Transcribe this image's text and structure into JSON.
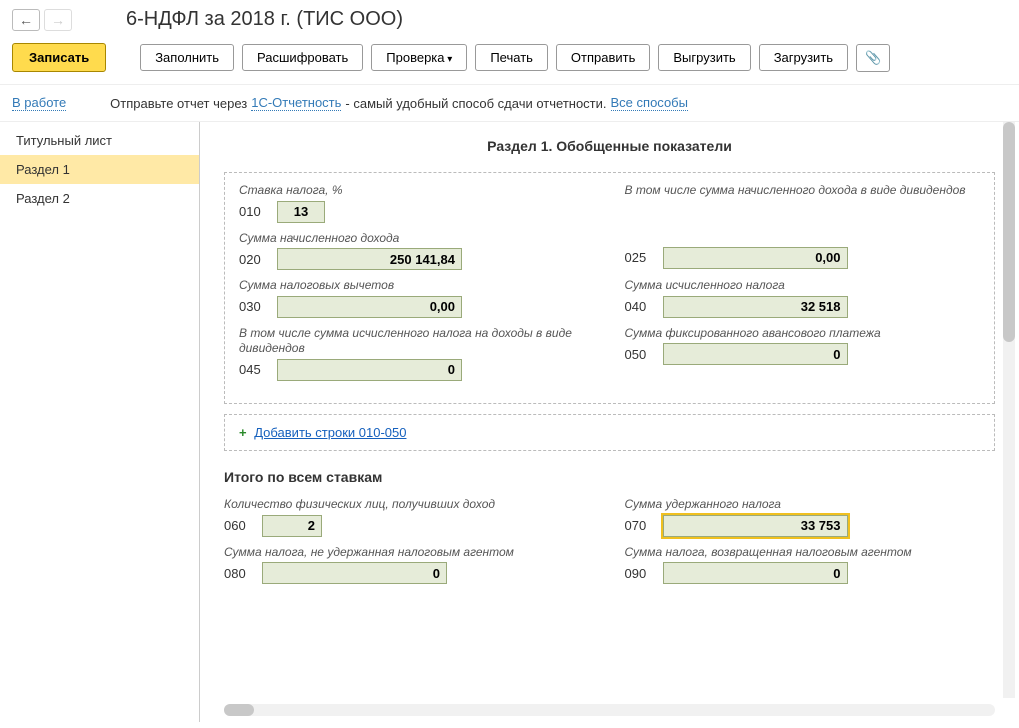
{
  "header": {
    "title": "6-НДФЛ за 2018 г. (ТИС ООО)"
  },
  "toolbar": {
    "save": "Записать",
    "fill": "Заполнить",
    "decrypt": "Расшифровать",
    "check": "Проверка",
    "print": "Печать",
    "send": "Отправить",
    "unload": "Выгрузить",
    "load": "Загрузить"
  },
  "status": {
    "label": "В работе",
    "hint_prefix": "Отправьте отчет через",
    "hint_link": "1С-Отчетность",
    "hint_suffix": "- самый удобный способ сдачи отчетности.",
    "all_ways": "Все способы"
  },
  "nav": {
    "title_page": "Титульный лист",
    "section1": "Раздел 1",
    "section2": "Раздел 2"
  },
  "section1": {
    "heading": "Раздел 1. Обобщенные показатели",
    "labels": {
      "rate": "Ставка налога, %",
      "income_sum": "Сумма начисленного дохода",
      "income_div": "В том числе сумма начисленного дохода в виде дивидендов",
      "deductions": "Сумма налоговых вычетов",
      "calc_tax": "Сумма исчисленного налога",
      "calc_tax_div": "В том числе сумма исчисленного налога на доходы в виде дивидендов",
      "fixed_advance": "Сумма фиксированного авансового платежа"
    },
    "codes": {
      "c010": "010",
      "c020": "020",
      "c025": "025",
      "c030": "030",
      "c040": "040",
      "c045": "045",
      "c050": "050"
    },
    "values": {
      "v010": "13",
      "v020": "250 141,84",
      "v025": "0,00",
      "v030": "0,00",
      "v040": "32 518",
      "v045": "0",
      "v050": "0"
    },
    "add_rows": "Добавить строки 010-050"
  },
  "totals": {
    "heading": "Итого по всем ставкам",
    "labels": {
      "persons": "Количество физических лиц, получивших доход",
      "withheld": "Сумма удержанного налога",
      "not_withheld": "Сумма налога, не удержанная налоговым агентом",
      "returned": "Сумма налога, возвращенная налоговым агентом"
    },
    "codes": {
      "c060": "060",
      "c070": "070",
      "c080": "080",
      "c090": "090"
    },
    "values": {
      "v060": "2",
      "v070": "33 753",
      "v080": "0",
      "v090": "0"
    }
  }
}
